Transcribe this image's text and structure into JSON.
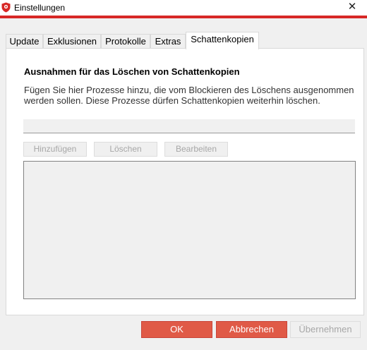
{
  "window": {
    "title": "Einstellungen",
    "close_icon": "close-icon",
    "accent_color": "#d72826"
  },
  "tabs": [
    {
      "label": "Update"
    },
    {
      "label": "Exklusionen"
    },
    {
      "label": "Protokolle"
    },
    {
      "label": "Extras"
    },
    {
      "label": "Schattenkopien",
      "active": true
    }
  ],
  "content": {
    "heading": "Ausnahmen für das Löschen von Schattenkopien",
    "description": "Fügen Sie hier Prozesse hinzu, die vom Blockieren des Löschens ausgenommen werden sollen. Diese Prozesse dürfen Schattenkopien weiterhin löschen.",
    "process_input": {
      "value": "",
      "placeholder": ""
    },
    "buttons": {
      "add": "Hinzufügen",
      "delete": "Löschen",
      "edit": "Bearbeiten"
    }
  },
  "footer": {
    "ok": "OK",
    "cancel": "Abbrechen",
    "apply": "Übernehmen"
  },
  "colors": {
    "primary_button": "#e05a47",
    "disabled_text": "#a7a7a7"
  }
}
